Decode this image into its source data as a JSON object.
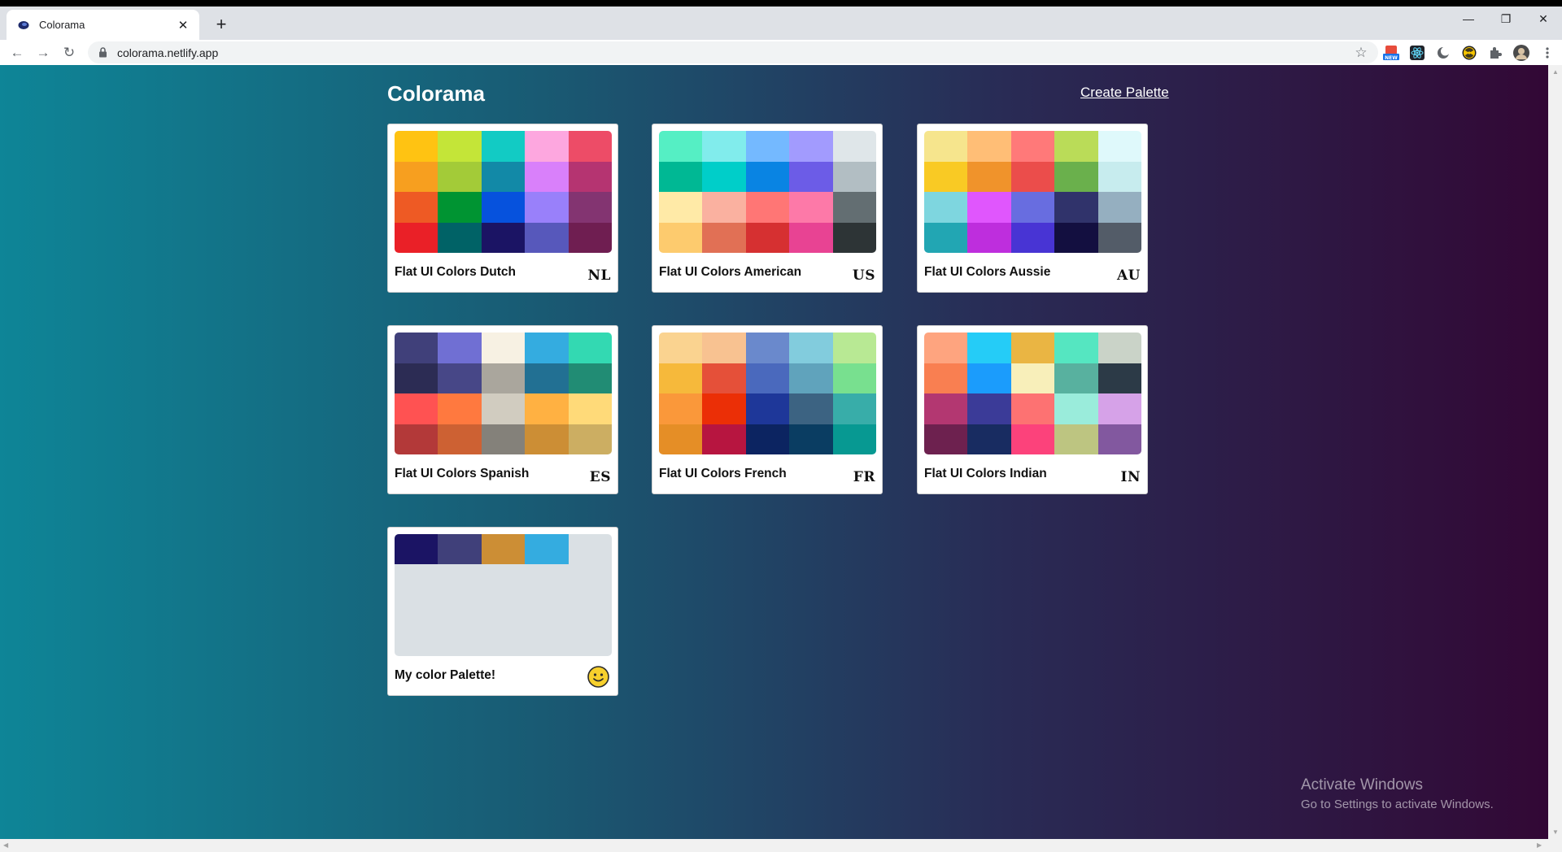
{
  "browser": {
    "tab_title": "Colorama",
    "url": "colorama.netlify.app",
    "new_tab_label": "+",
    "tab_close_label": "✕",
    "nav": {
      "back": "←",
      "forward": "→",
      "reload": "↻"
    },
    "window_controls": {
      "minimize": "—",
      "restore": "❐",
      "close": "✕"
    },
    "star_label": "☆",
    "extensions": [
      "new-badge-icon",
      "react-icon",
      "dark-mode-icon",
      "radiation-icon",
      "puzzle-icon",
      "profile-avatar",
      "menu-icon"
    ]
  },
  "page": {
    "brand": "Colorama",
    "create_link": "Create Palette"
  },
  "palettes": [
    {
      "name": "Flat UI Colors Dutch",
      "code": "NL",
      "colors": [
        "#FFC312",
        "#C4E538",
        "#12CBC4",
        "#FDA7DF",
        "#ED4C67",
        "#F79F1F",
        "#A3CB38",
        "#1289A7",
        "#D980FA",
        "#B53471",
        "#EE5A24",
        "#009432",
        "#0652DD",
        "#9980FA",
        "#833471",
        "#EA2027",
        "#006266",
        "#1B1464",
        "#5758BB",
        "#6F1E51"
      ]
    },
    {
      "name": "Flat UI Colors American",
      "code": "US",
      "colors": [
        "#55efc4",
        "#81ecec",
        "#74b9ff",
        "#a29bfe",
        "#dfe6e9",
        "#00b894",
        "#00cec9",
        "#0984e3",
        "#6c5ce7",
        "#b2bec3",
        "#ffeaa7",
        "#fab1a0",
        "#ff7675",
        "#fd79a8",
        "#636e72",
        "#fdcb6e",
        "#e17055",
        "#d63031",
        "#e84393",
        "#2d3436"
      ]
    },
    {
      "name": "Flat UI Colors Aussie",
      "code": "AU",
      "colors": [
        "#f6e58d",
        "#ffbe76",
        "#ff7979",
        "#badc58",
        "#dff9fb",
        "#f9ca24",
        "#f0932b",
        "#eb4d4b",
        "#6ab04c",
        "#c7ecee",
        "#7ed6df",
        "#e056fd",
        "#686de0",
        "#30336b",
        "#95afc0",
        "#22a6b3",
        "#be2edd",
        "#4834d4",
        "#130f40",
        "#535c68"
      ]
    },
    {
      "name": "Flat UI Colors Spanish",
      "code": "ES",
      "colors": [
        "#40407a",
        "#706fd3",
        "#f7f1e3",
        "#34ace0",
        "#33d9b2",
        "#2c2c54",
        "#474787",
        "#aaa69d",
        "#227093",
        "#218c74",
        "#ff5252",
        "#ff793f",
        "#d1ccc0",
        "#ffb142",
        "#ffda79",
        "#b33939",
        "#cd6133",
        "#84817a",
        "#cc8e35",
        "#ccae62"
      ]
    },
    {
      "name": "Flat UI Colors French",
      "code": "FR",
      "colors": [
        "#fad390",
        "#f8c291",
        "#6a89cc",
        "#82ccdd",
        "#b8e994",
        "#f6b93b",
        "#e55039",
        "#4a69bd",
        "#60a3bc",
        "#78e08f",
        "#fa983a",
        "#eb2f06",
        "#1e3799",
        "#3c6382",
        "#38ada9",
        "#e58e26",
        "#b71540",
        "#0c2461",
        "#0a3d62",
        "#079992"
      ]
    },
    {
      "name": "Flat UI Colors Indian",
      "code": "IN",
      "colors": [
        "#FEA47F",
        "#25CCF7",
        "#EAB543",
        "#55E6C1",
        "#CAD3C8",
        "#F97F51",
        "#1B9CFC",
        "#F8EFBA",
        "#58B19F",
        "#2C3A47",
        "#B33771",
        "#3B3B98",
        "#FD7272",
        "#9AECDB",
        "#D6A2E8",
        "#6D214F",
        "#182C61",
        "#FC427B",
        "#BDC581",
        "#82589F"
      ]
    },
    {
      "name": "My color Palette!",
      "code": "",
      "emoji": "slightly-smiling-face-icon",
      "colors": [
        "#1B1464",
        "#40407a",
        "#cc8e35",
        "#34ace0"
      ]
    }
  ],
  "watermark": {
    "line1": "Activate Windows",
    "line2": "Go to Settings to activate Windows."
  }
}
